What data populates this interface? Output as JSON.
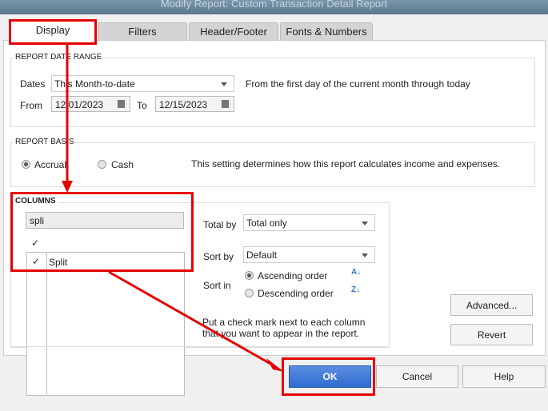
{
  "window": {
    "title": "Modify Report: Custom Transaction Detail Report"
  },
  "tabs": [
    {
      "label": "Display"
    },
    {
      "label": "Filters"
    },
    {
      "label": "Header/Footer"
    },
    {
      "label": "Fonts & Numbers"
    }
  ],
  "date_range": {
    "heading": "REPORT DATE RANGE",
    "dates_label": "Dates",
    "dates_value": "This Month-to-date",
    "description": "From the first day of the current month through today",
    "from_label": "From",
    "from_value": "12/01/2023",
    "to_label": "To",
    "to_value": "12/15/2023"
  },
  "basis": {
    "heading": "REPORT BASIS",
    "accrual": "Accrual",
    "cash": "Cash",
    "selected": "Accrual",
    "description": "This setting determines how this report calculates income and expenses."
  },
  "columns": {
    "heading": "COLUMNS",
    "search_value": "spli",
    "header_check": "✓",
    "items": [
      {
        "checked": "✓",
        "label": "Split"
      }
    ],
    "total_by_label": "Total by",
    "total_by_value": "Total only",
    "sort_by_label": "Sort by",
    "sort_by_value": "Default",
    "sort_in_label": "Sort in",
    "ascending": "Ascending order",
    "descending": "Descending order",
    "sort_selected": "Ascending order",
    "hint": "Put a check mark next to each column that you want to appear in the report."
  },
  "buttons": {
    "advanced": "Advanced...",
    "revert": "Revert",
    "ok": "OK",
    "cancel": "Cancel",
    "help": "Help"
  },
  "annotation_color": "#e60000"
}
